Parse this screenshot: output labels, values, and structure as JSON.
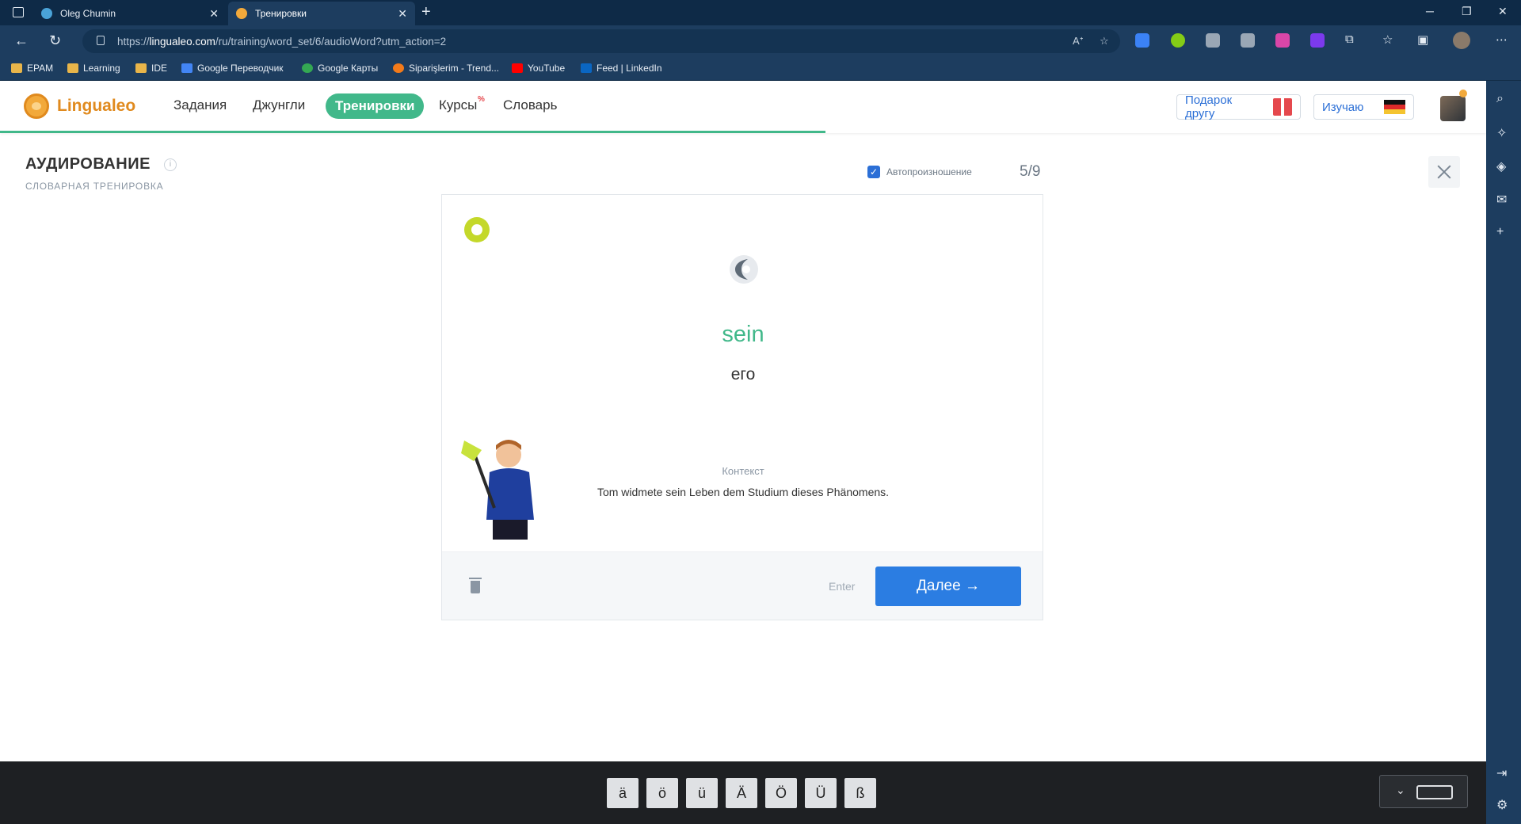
{
  "browser": {
    "tabs": [
      {
        "title": "Oleg Chumin",
        "active": false
      },
      {
        "title": "Тренировки",
        "active": true
      }
    ],
    "url_prefix": "https://",
    "url_host": "lingualeo.com",
    "url_path": "/ru/training/word_set/6/audioWord?utm_action=2",
    "bookmarks": [
      "EPAM",
      "Learning",
      "IDE",
      "Google Переводчик",
      "Google Карты",
      "Siparişlerim - Trend...",
      "YouTube",
      "Feed | LinkedIn"
    ]
  },
  "site": {
    "logo": "Lingualeo",
    "nav": [
      "Задания",
      "Джунгли",
      "Тренировки",
      "Курсы",
      "Словарь"
    ],
    "courses_badge": "%",
    "gift_button": "Подарок другу",
    "learning_button": "Изучаю"
  },
  "training": {
    "title": "АУДИРОВАНИЕ",
    "subtitle": "СЛОВАРНАЯ ТРЕНИРОВКА",
    "auto_pronounce_label": "Автопроизношение",
    "auto_pronounce_checked": true,
    "counter": "5/9",
    "word": "sein",
    "translation": "его",
    "context_label": "Контекст",
    "context_text": "Tom widmete sein Leben dem Studium dieses Phänomens.",
    "enter_hint": "Enter",
    "next_button": "Далее →"
  },
  "keyboard": {
    "keys": [
      "ä",
      "ö",
      "ü",
      "Ä",
      "Ö",
      "Ü",
      "ß"
    ]
  },
  "colors": {
    "accent_green": "#41b88a",
    "button_blue": "#2b7de2",
    "chrome_dark": "#0e2a47",
    "chrome_mid": "#1d3d5f"
  }
}
